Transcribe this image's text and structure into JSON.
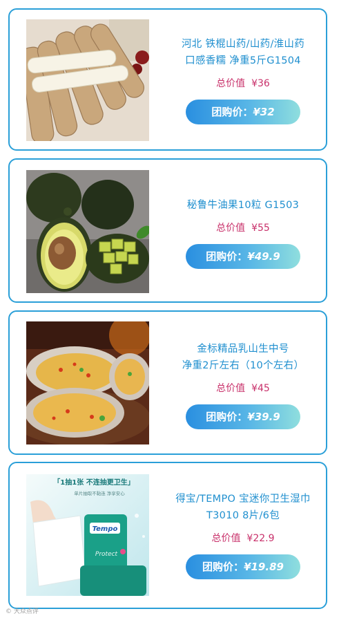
{
  "products": [
    {
      "title_line1": "河北 铁棍山药/山药/淮山药",
      "title_line2": "口感香糯 净重5斤G1504",
      "total_label": "总价值",
      "total_price": "¥36",
      "group_label": "团购价：",
      "group_price": "¥32",
      "image_icon": "chinese-yam-photo"
    },
    {
      "title_line1": "秘鲁牛油果10粒 G1503",
      "title_line2": "",
      "total_label": "总价值",
      "total_price": "¥55",
      "group_label": "团购价：",
      "group_price": "¥49.9",
      "image_icon": "avocado-photo"
    },
    {
      "title_line1": "金标精品乳山生中号",
      "title_line2": "净重2斤左右（10个左右）",
      "total_label": "总价值",
      "total_price": "¥45",
      "group_label": "团购价：",
      "group_price": "¥39.9",
      "image_icon": "oyster-photo"
    },
    {
      "title_line1": "得宝/TEMPO 宝迷你卫生湿巾",
      "title_line2": "T3010 8片/6包",
      "total_label": "总价值",
      "total_price": "¥22.9",
      "group_label": "团购价：",
      "group_price": "¥19.89",
      "image_icon": "wet-wipes-photo",
      "image_text": {
        "headline": "「1抽1张 不连抽更卫生」",
        "sub": "单片抽取不黏连 净享安心",
        "brand": "Tempo",
        "tag": "Protect"
      }
    }
  ],
  "watermark": "© 大众点评",
  "colors": {
    "border": "#2a9fd8",
    "title": "#1f8fcf",
    "total": "#c8306a"
  }
}
